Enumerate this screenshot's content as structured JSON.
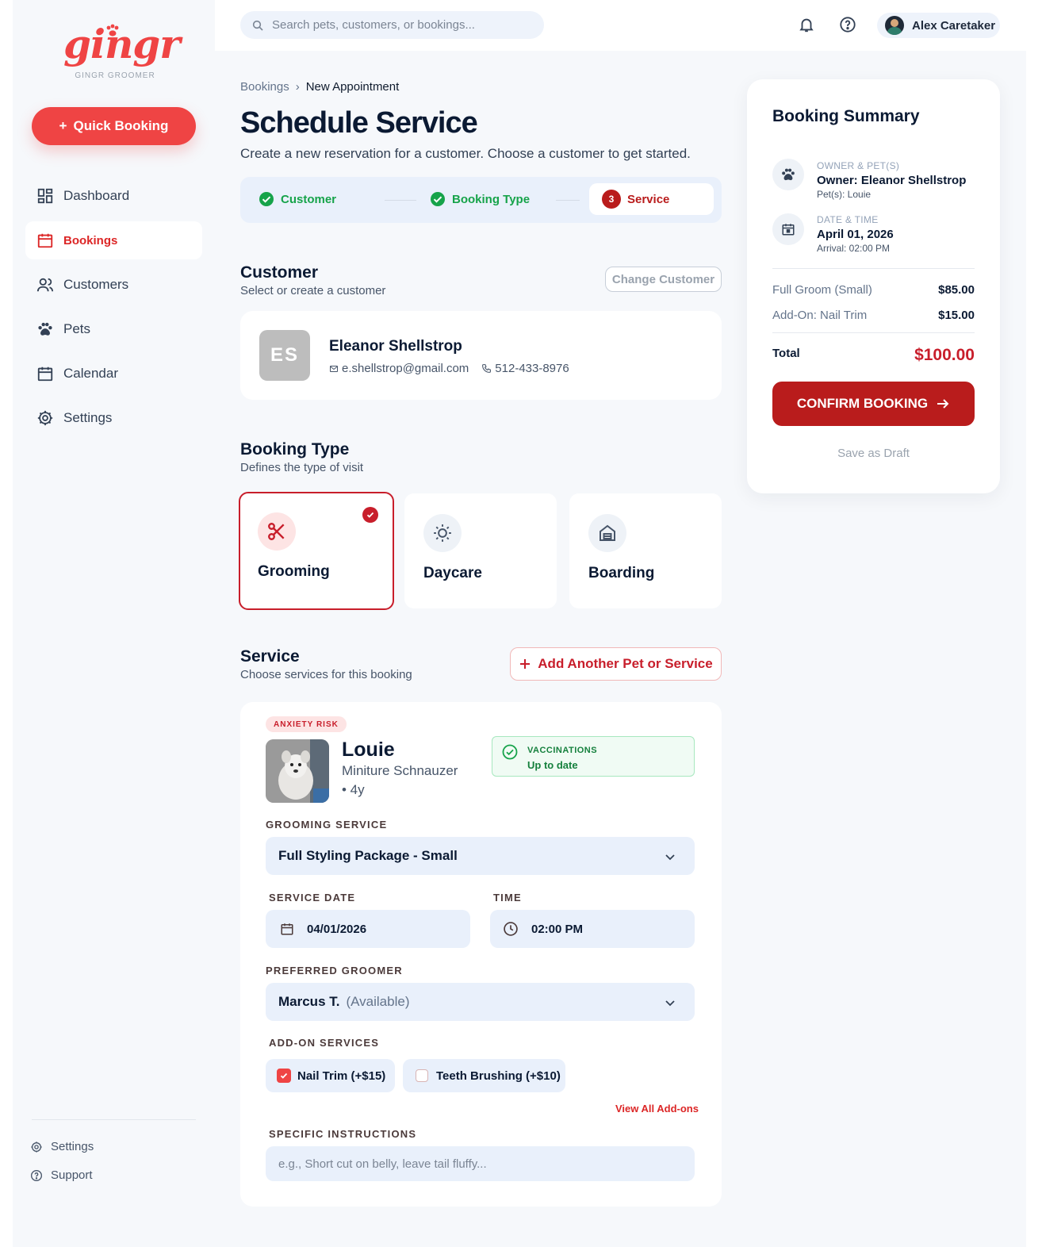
{
  "brand": {
    "logo_text": "gingr",
    "subtitle": "GINGR GROOMER",
    "accent": "#ef4444",
    "primary": "#b91c1c"
  },
  "sidebar": {
    "quick_booking": "Quick Booking",
    "items": [
      {
        "label": "Dashboard",
        "icon": "dashboard-icon"
      },
      {
        "label": "Bookings",
        "icon": "calendar-icon"
      },
      {
        "label": "Customers",
        "icon": "users-icon"
      },
      {
        "label": "Pets",
        "icon": "paw-icon"
      },
      {
        "label": "Calendar",
        "icon": "calendar-icon"
      },
      {
        "label": "Settings",
        "icon": "gear-icon"
      }
    ],
    "footer": [
      {
        "label": "Settings",
        "icon": "gear-icon"
      },
      {
        "label": "Support",
        "icon": "help-icon"
      }
    ]
  },
  "topbar": {
    "search_placeholder": "Search pets, customers, or bookings...",
    "user_name": "Alex Caretaker"
  },
  "breadcrumb": {
    "parent": "Bookings",
    "current": "New Appointment"
  },
  "page": {
    "title": "Schedule Service",
    "subtitle": "Create a new reservation for a customer. Choose a customer to get started."
  },
  "stepper": {
    "steps": [
      {
        "label": "Customer",
        "status": "done"
      },
      {
        "label": "Booking Type",
        "status": "done"
      },
      {
        "label": "Service",
        "status": "current",
        "number": "3"
      }
    ]
  },
  "customer": {
    "title": "Customer",
    "subtitle": "Select or create a customer",
    "change_label": "Change Customer",
    "initials": "ES",
    "name": "Eleanor Shellstrop",
    "email": "e.shellstrop@gmail.com",
    "phone": "512-433-8976"
  },
  "booking_type": {
    "title": "Booking Type",
    "subtitle": "Defines the type of visit",
    "options": [
      {
        "label": "Grooming",
        "icon": "scissors-icon",
        "selected": true
      },
      {
        "label": "Daycare",
        "icon": "sun-icon",
        "selected": false
      },
      {
        "label": "Boarding",
        "icon": "house-icon",
        "selected": false
      }
    ]
  },
  "service": {
    "title": "Service",
    "subtitle": "Choose services for this booking",
    "add_label": "Add Another Pet or Service",
    "pet": {
      "badge": "ANXIETY RISK",
      "name": "Louie",
      "breed": "Miniture Schnauzer",
      "age": "• 4y",
      "vacc_title": "VACCINATIONS",
      "vacc_status": "Up to date"
    },
    "grooming_label": "GROOMING SERVICE",
    "grooming_value": "Full Styling Package - Small",
    "date_label": "SERVICE DATE",
    "date_value": "04/01/2026",
    "time_label": "TIME",
    "time_value": "02:00 PM",
    "groomer_label": "PREFERRED GROOMER",
    "groomer_value": "Marcus T.",
    "groomer_status": "(Available)",
    "addons_label": "ADD-ON SERVICES",
    "addons": [
      {
        "label": "Nail Trim (+$15)",
        "checked": true
      },
      {
        "label": "Teeth Brushing (+$10)",
        "checked": false
      }
    ],
    "view_all": "View All Add-ons",
    "instructions_label": "SPECIFIC INSTRUCTIONS",
    "instructions_placeholder": "e.g., Short cut on belly, leave tail fluffy..."
  },
  "summary": {
    "title": "Booking Summary",
    "owner_key": "OWNER & PET(S)",
    "owner_value": "Owner: Eleanor Shellstrop",
    "pets_value": "Pet(s): Louie",
    "date_key": "DATE & TIME",
    "date_value": "April 01, 2026",
    "arrival_value": "Arrival: 02:00 PM",
    "line_items": [
      {
        "name": "Full Groom (Small)",
        "price": "$85.00"
      },
      {
        "name": "Add-On: Nail Trim",
        "price": "$15.00"
      }
    ],
    "total_label": "Total",
    "total_value": "$100.00",
    "confirm_label": "CONFIRM BOOKING",
    "draft_label": "Save as Draft"
  }
}
